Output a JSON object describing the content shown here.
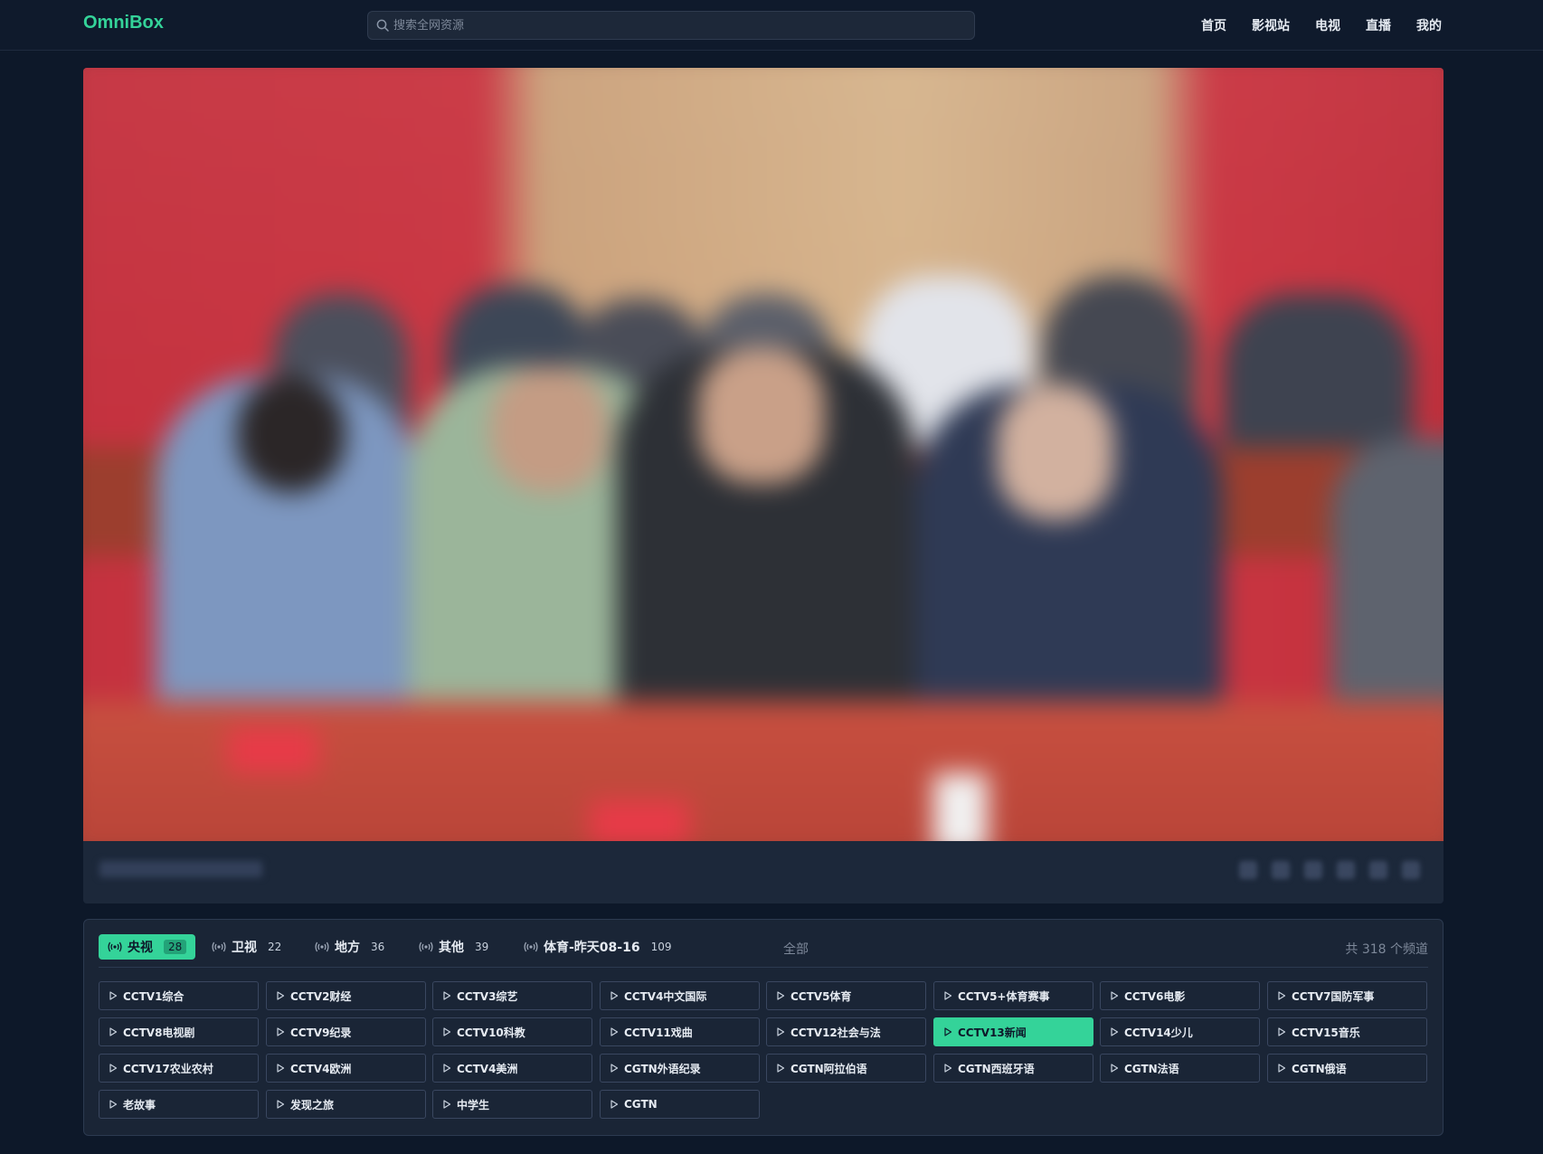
{
  "header": {
    "logo": "OmniBox",
    "search_placeholder": "搜索全网资源",
    "nav": [
      "首页",
      "影视站",
      "电视",
      "直播",
      "我的"
    ]
  },
  "colors": {
    "accent": "#34d399",
    "background": "#0d1829",
    "panel": "#1a2536"
  },
  "player": {
    "state": "playing",
    "content": "blurred video frame"
  },
  "channels": {
    "tabs": [
      {
        "label": "央视",
        "count": "28",
        "icon": "broadcast-icon",
        "active": true
      },
      {
        "label": "卫视",
        "count": "22",
        "icon": "broadcast-icon",
        "active": false
      },
      {
        "label": "地方",
        "count": "36",
        "icon": "broadcast-icon",
        "active": false
      },
      {
        "label": "其他",
        "count": "39",
        "icon": "broadcast-icon",
        "active": false
      },
      {
        "label": "体育-昨天08-16",
        "count": "109",
        "icon": "broadcast-icon",
        "active": false
      }
    ],
    "all_label": "全部",
    "total": "共 318 个频道",
    "items": [
      "CCTV1综合",
      "CCTV2财经",
      "CCTV3综艺",
      "CCTV4中文国际",
      "CCTV5体育",
      "CCTV5+体育赛事",
      "CCTV6电影",
      "CCTV7国防军事",
      "CCTV8电视剧",
      "CCTV9纪录",
      "CCTV10科教",
      "CCTV11戏曲",
      "CCTV12社会与法",
      "CCTV13新闻",
      "CCTV14少儿",
      "CCTV15音乐",
      "CCTV17农业农村",
      "CCTV4欧洲",
      "CCTV4美洲",
      "CGTN外语纪录",
      "CGTN阿拉伯语",
      "CGTN西班牙语",
      "CGTN法语",
      "CGTN俄语",
      "老故事",
      "发现之旅",
      "中学生",
      "CGTN"
    ],
    "active_item": "CCTV13新闻"
  }
}
